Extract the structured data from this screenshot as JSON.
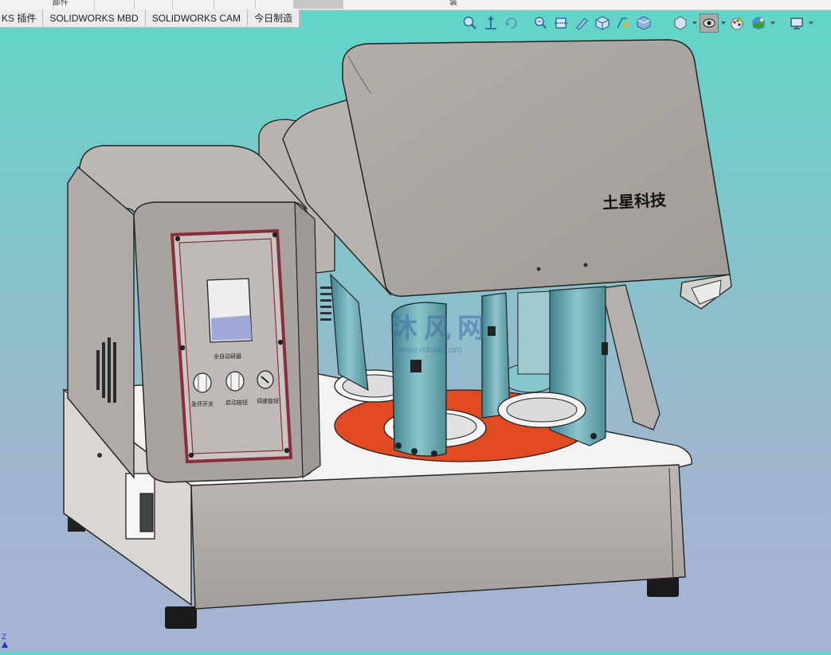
{
  "ribbon": {
    "partial_labels": [
      "部件",
      "装"
    ],
    "accent": "#c8c8c8"
  },
  "tabs": [
    {
      "label": "KS 插件"
    },
    {
      "label": "SOLIDWORKS MBD"
    },
    {
      "label": "SOLIDWORKS CAM"
    },
    {
      "label": "今日制造"
    }
  ],
  "hud_icons": [
    "zoom-to-fit-icon",
    "zoom-to-area-icon",
    "previous-view-icon",
    "section-view-icon",
    "dynamic-annotation-icon",
    "view-orientation-icon",
    "display-style-icon",
    "hide-show-items-icon",
    "edit-appearance-icon",
    "apply-scene-icon",
    "view-settings-icon"
  ],
  "model": {
    "brand_text": "土星科技",
    "watermark_text": "沐风网",
    "watermark_url": "www.mfcad.com",
    "panel_caption": "全自动研磨",
    "knob_labels": [
      "急停开关",
      "启动按钮",
      "调速旋钮"
    ],
    "colors": {
      "housing": "#a49f9a",
      "panel_border": "#8a2d3c",
      "base": "#efefef",
      "jar": "#6fa6ad",
      "turntable": "#e24a21"
    }
  },
  "triad": {
    "axis_label": "Z"
  }
}
